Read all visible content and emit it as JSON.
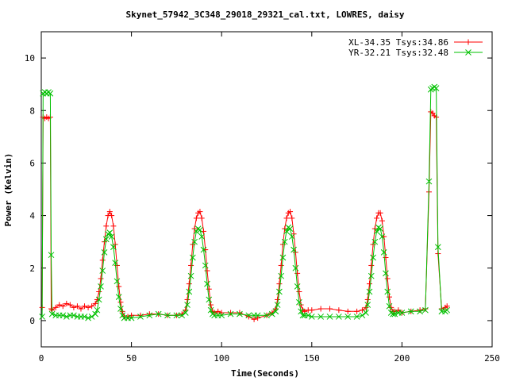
{
  "chart_data": {
    "type": "line",
    "title": "Skynet_57942_3C348_29018_29321_cal.txt, LOWRES, daisy",
    "xlabel": "Time(Seconds)",
    "ylabel": "Power (Kelvin)",
    "xlim": [
      0,
      250
    ],
    "ylim": [
      -1,
      11
    ],
    "xticks": [
      0,
      50,
      100,
      150,
      200,
      250
    ],
    "yticks": [
      0,
      2,
      4,
      6,
      8,
      10
    ],
    "xtick_labels": [
      "0",
      "50",
      "100",
      "150",
      "200",
      "250"
    ],
    "ytick_labels": [
      "0",
      "2",
      "4",
      "6",
      "8",
      "10"
    ],
    "grid": false,
    "legend_position": "top-right",
    "series": [
      {
        "name": "XL-34.35 Tsys:34.86",
        "color": "#ff0000",
        "marker": "plus",
        "x": [
          0.5,
          1,
          2,
          3,
          4,
          5,
          5.5,
          6,
          8,
          10,
          12,
          14,
          16,
          18,
          20,
          22,
          24,
          26,
          28,
          30,
          31,
          32,
          33,
          34,
          35,
          36,
          37,
          38,
          39,
          40,
          41,
          42,
          43,
          44,
          45,
          46,
          48,
          50,
          55,
          60,
          65,
          70,
          75,
          78,
          80,
          81,
          82,
          83,
          84,
          85,
          86,
          87,
          88,
          89,
          90,
          91,
          92,
          93,
          94,
          95,
          96,
          98,
          100,
          105,
          110,
          115,
          118,
          120,
          125,
          128,
          130,
          131,
          132,
          133,
          134,
          135,
          136,
          137,
          138,
          139,
          140,
          141,
          142,
          143,
          144,
          145,
          146,
          148,
          150,
          155,
          160,
          165,
          170,
          175,
          178,
          180,
          181,
          182,
          183,
          184,
          185,
          186,
          187,
          188,
          189,
          190,
          191,
          192,
          193,
          194,
          195,
          196,
          198,
          200,
          205,
          210,
          213,
          215,
          216,
          217,
          218,
          219,
          220,
          222,
          224,
          225
        ],
        "y": [
          0.5,
          7.75,
          7.7,
          7.75,
          7.7,
          7.75,
          0.45,
          0.4,
          0.5,
          0.6,
          0.55,
          0.65,
          0.6,
          0.5,
          0.55,
          0.45,
          0.55,
          0.5,
          0.55,
          0.65,
          0.8,
          1.1,
          1.6,
          2.3,
          3.0,
          3.6,
          4.0,
          4.15,
          4.0,
          3.6,
          2.9,
          2.1,
          1.3,
          0.7,
          0.35,
          0.15,
          0.15,
          0.2,
          0.2,
          0.25,
          0.25,
          0.2,
          0.2,
          0.25,
          0.4,
          0.8,
          1.4,
          2.1,
          2.9,
          3.5,
          3.9,
          4.1,
          4.15,
          3.9,
          3.4,
          2.7,
          1.9,
          1.2,
          0.6,
          0.35,
          0.3,
          0.35,
          0.3,
          0.3,
          0.3,
          0.15,
          0.05,
          0.1,
          0.2,
          0.3,
          0.45,
          0.8,
          1.4,
          2.1,
          2.9,
          3.5,
          3.9,
          4.1,
          4.15,
          3.9,
          3.3,
          2.6,
          1.8,
          1.1,
          0.6,
          0.4,
          0.35,
          0.4,
          0.4,
          0.45,
          0.45,
          0.4,
          0.35,
          0.35,
          0.4,
          0.5,
          0.8,
          1.4,
          2.1,
          2.9,
          3.5,
          3.9,
          4.1,
          4.1,
          3.8,
          3.2,
          2.4,
          1.6,
          0.9,
          0.5,
          0.35,
          0.35,
          0.4,
          0.3,
          0.35,
          0.4,
          0.45,
          4.9,
          7.95,
          7.9,
          7.8,
          7.75,
          2.55,
          0.45,
          0.5,
          0.55
        ]
      },
      {
        "name": "YR-32.21 Tsys:32.48",
        "color": "#00c000",
        "marker": "cross",
        "x": [
          0.5,
          1,
          2,
          3,
          4,
          5,
          5.5,
          6,
          8,
          10,
          12,
          14,
          16,
          18,
          20,
          22,
          24,
          26,
          28,
          30,
          31,
          32,
          33,
          34,
          35,
          36,
          37,
          38,
          39,
          40,
          41,
          42,
          43,
          44,
          45,
          46,
          48,
          50,
          55,
          60,
          65,
          70,
          75,
          78,
          80,
          81,
          82,
          83,
          84,
          85,
          86,
          87,
          88,
          89,
          90,
          91,
          92,
          93,
          94,
          95,
          96,
          98,
          100,
          105,
          110,
          115,
          118,
          120,
          125,
          128,
          130,
          131,
          132,
          133,
          134,
          135,
          136,
          137,
          138,
          139,
          140,
          141,
          142,
          143,
          144,
          145,
          146,
          148,
          150,
          155,
          160,
          165,
          170,
          175,
          178,
          180,
          181,
          182,
          183,
          184,
          185,
          186,
          187,
          188,
          189,
          190,
          191,
          192,
          193,
          194,
          195,
          196,
          198,
          200,
          205,
          210,
          213,
          215,
          216,
          217,
          218,
          219,
          220,
          222,
          224,
          225
        ],
        "y": [
          0.15,
          8.65,
          8.7,
          8.65,
          8.7,
          8.65,
          2.5,
          0.25,
          0.2,
          0.2,
          0.2,
          0.15,
          0.2,
          0.2,
          0.15,
          0.15,
          0.15,
          0.1,
          0.15,
          0.25,
          0.4,
          0.8,
          1.3,
          1.9,
          2.6,
          3.1,
          3.3,
          3.35,
          3.2,
          2.8,
          2.2,
          1.5,
          0.9,
          0.45,
          0.2,
          0.1,
          0.1,
          0.1,
          0.15,
          0.2,
          0.25,
          0.2,
          0.2,
          0.2,
          0.3,
          0.6,
          1.1,
          1.7,
          2.4,
          3.0,
          3.4,
          3.5,
          3.45,
          3.2,
          2.7,
          2.1,
          1.4,
          0.8,
          0.4,
          0.25,
          0.2,
          0.2,
          0.2,
          0.25,
          0.25,
          0.2,
          0.2,
          0.2,
          0.2,
          0.25,
          0.35,
          0.6,
          1.1,
          1.7,
          2.4,
          3.0,
          3.4,
          3.55,
          3.5,
          3.2,
          2.7,
          2.0,
          1.3,
          0.7,
          0.35,
          0.2,
          0.2,
          0.2,
          0.15,
          0.15,
          0.15,
          0.15,
          0.15,
          0.15,
          0.2,
          0.3,
          0.6,
          1.1,
          1.7,
          2.4,
          3.0,
          3.4,
          3.55,
          3.5,
          3.2,
          2.6,
          1.8,
          1.1,
          0.55,
          0.3,
          0.25,
          0.25,
          0.3,
          0.3,
          0.35,
          0.35,
          0.4,
          5.3,
          8.8,
          8.85,
          8.9,
          8.85,
          2.8,
          0.35,
          0.35,
          0.4
        ]
      }
    ]
  }
}
